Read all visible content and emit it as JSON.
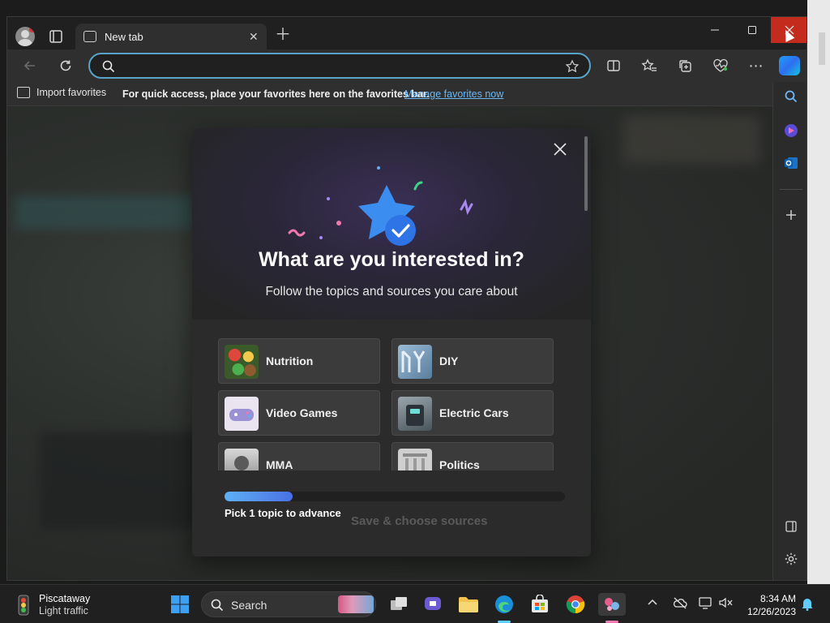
{
  "browser": {
    "tab_title": "New tab",
    "address_value": "",
    "toolbar_icons": [
      "back-icon",
      "refresh-icon",
      "search-icon",
      "star-icon",
      "split-screen-icon",
      "favorites-icon",
      "collections-icon",
      "browser-essentials-icon",
      "more-icon",
      "copilot-icon"
    ],
    "favorites_bar": {
      "import_label": "Import favorites",
      "message": "For quick access, place your favorites here on the favorites bar.",
      "manage_link": "Manage favorites now"
    },
    "sidebar_icons": [
      "search-icon",
      "copilot-icon",
      "outlook-icon",
      "add-icon",
      "hide-sidebar-icon",
      "settings-icon"
    ]
  },
  "modal": {
    "title": "What are you interested in?",
    "subtitle": "Follow the topics and sources you care about",
    "topics": [
      {
        "label": "Nutrition"
      },
      {
        "label": "DIY"
      },
      {
        "label": "Video Games"
      },
      {
        "label": "Electric Cars"
      },
      {
        "label": "MMA"
      },
      {
        "label": "Politics"
      }
    ],
    "progress_fraction": 0.2,
    "progress_label": "Pick 1 topic to advance",
    "save_label": "Save & choose sources"
  },
  "taskbar": {
    "weather_location": "Piscataway",
    "weather_status": "Light traffic",
    "search_label": "Search",
    "time": "8:34 AM",
    "date": "12/26/2023"
  },
  "colors": {
    "accent": "#60cdff",
    "link": "#6cb8f6",
    "close_red": "#c42b1c",
    "progress_start": "#5fb0f5",
    "progress_end": "#4a70e5"
  }
}
